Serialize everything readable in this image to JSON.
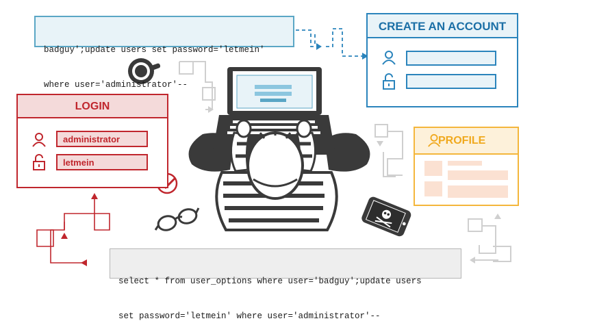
{
  "code_top": {
    "line1": "badguy';update users set password='letmein'",
    "line2": "where user='administrator'--"
  },
  "code_bottom": {
    "line1": "select * from user_options where user='badguy';update users",
    "line2": "set password='letmein' where user='administrator'--"
  },
  "create_account": {
    "title": "CREATE AN ACCOUNT"
  },
  "login": {
    "title": "LOGIN",
    "username": "administrator",
    "password": "letmein"
  },
  "profile": {
    "title": "PROFILE"
  },
  "colors": {
    "blue": "#2a84bc",
    "red": "#c0262d",
    "orange": "#f4b63b",
    "dark": "#333333"
  },
  "icons": [
    "user-icon",
    "lock-icon",
    "coffee-cup-icon",
    "glasses-icon",
    "phone-skull-icon",
    "checkmark-icon",
    "laptop-icon"
  ]
}
